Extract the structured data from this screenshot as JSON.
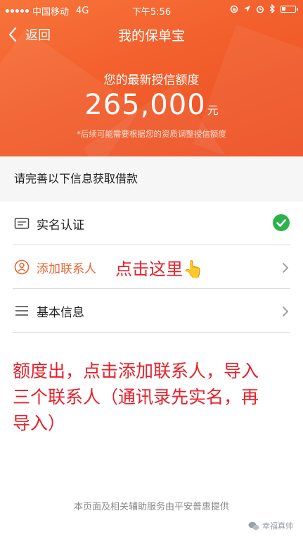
{
  "status_bar": {
    "carrier": "中国移动",
    "network": "4G",
    "time": "下午5:56"
  },
  "nav": {
    "back_label": "返回",
    "title": "我的保单宝"
  },
  "credit": {
    "label": "您的最新授信额度",
    "amount": "265,000",
    "unit": "元",
    "note": "*后续可能需要根据您的资质调整授信额度"
  },
  "section": {
    "header": "请完善以下信息获取借款"
  },
  "items": [
    {
      "label": "实名认证",
      "icon": "id-card-icon",
      "state": "done"
    },
    {
      "label": "添加联系人",
      "icon": "contact-icon",
      "state": "pending"
    },
    {
      "label": "基本信息",
      "icon": "list-icon",
      "state": "pending"
    }
  ],
  "annotations": {
    "inline": "点击这里👆",
    "block": "额度出，点击添加联系人，导入三个联系人（通讯录先实名，再导入）"
  },
  "footer": "本页面及相关辅助服务由平安普惠提供",
  "watermark": "幸福真帅",
  "colors": {
    "header_orange": "#f25f2c",
    "check_green": "#2cb24a",
    "contact_orange": "#e8662f",
    "annotation_red": "#e8202a"
  }
}
